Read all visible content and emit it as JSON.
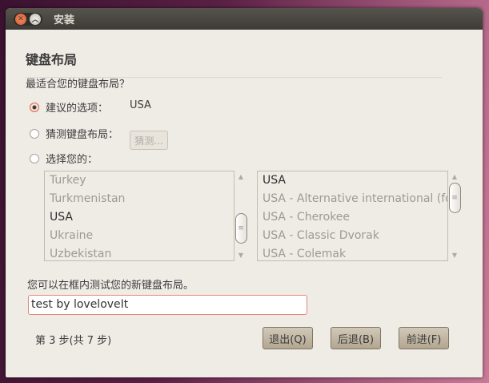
{
  "window": {
    "title": "安装"
  },
  "page": {
    "heading": "键盘布局",
    "question": "最适合您的键盘布局？"
  },
  "options": {
    "suggested_label": "建议的选项：",
    "suggested_value": "USA",
    "detect_label": "猜测键盘布局：",
    "detect_button": "猜测...",
    "choose_label": "选择您的："
  },
  "layouts": [
    "Turkey",
    "Turkmenistan",
    "USA",
    "Ukraine",
    "Uzbekistan"
  ],
  "variants": [
    "USA",
    "USA - Alternative international (former us_intl)",
    "USA - Cherokee",
    "USA - Classic Dvorak",
    "USA - Colemak"
  ],
  "test": {
    "label": "您可以在框内测试您的新键盘布局。",
    "value": "test by loveloveIt"
  },
  "footer": {
    "step": "第 3 步(共 7 步)",
    "quit": "退出(Q)",
    "back": "后退(B)",
    "forward": "前进(F)"
  }
}
